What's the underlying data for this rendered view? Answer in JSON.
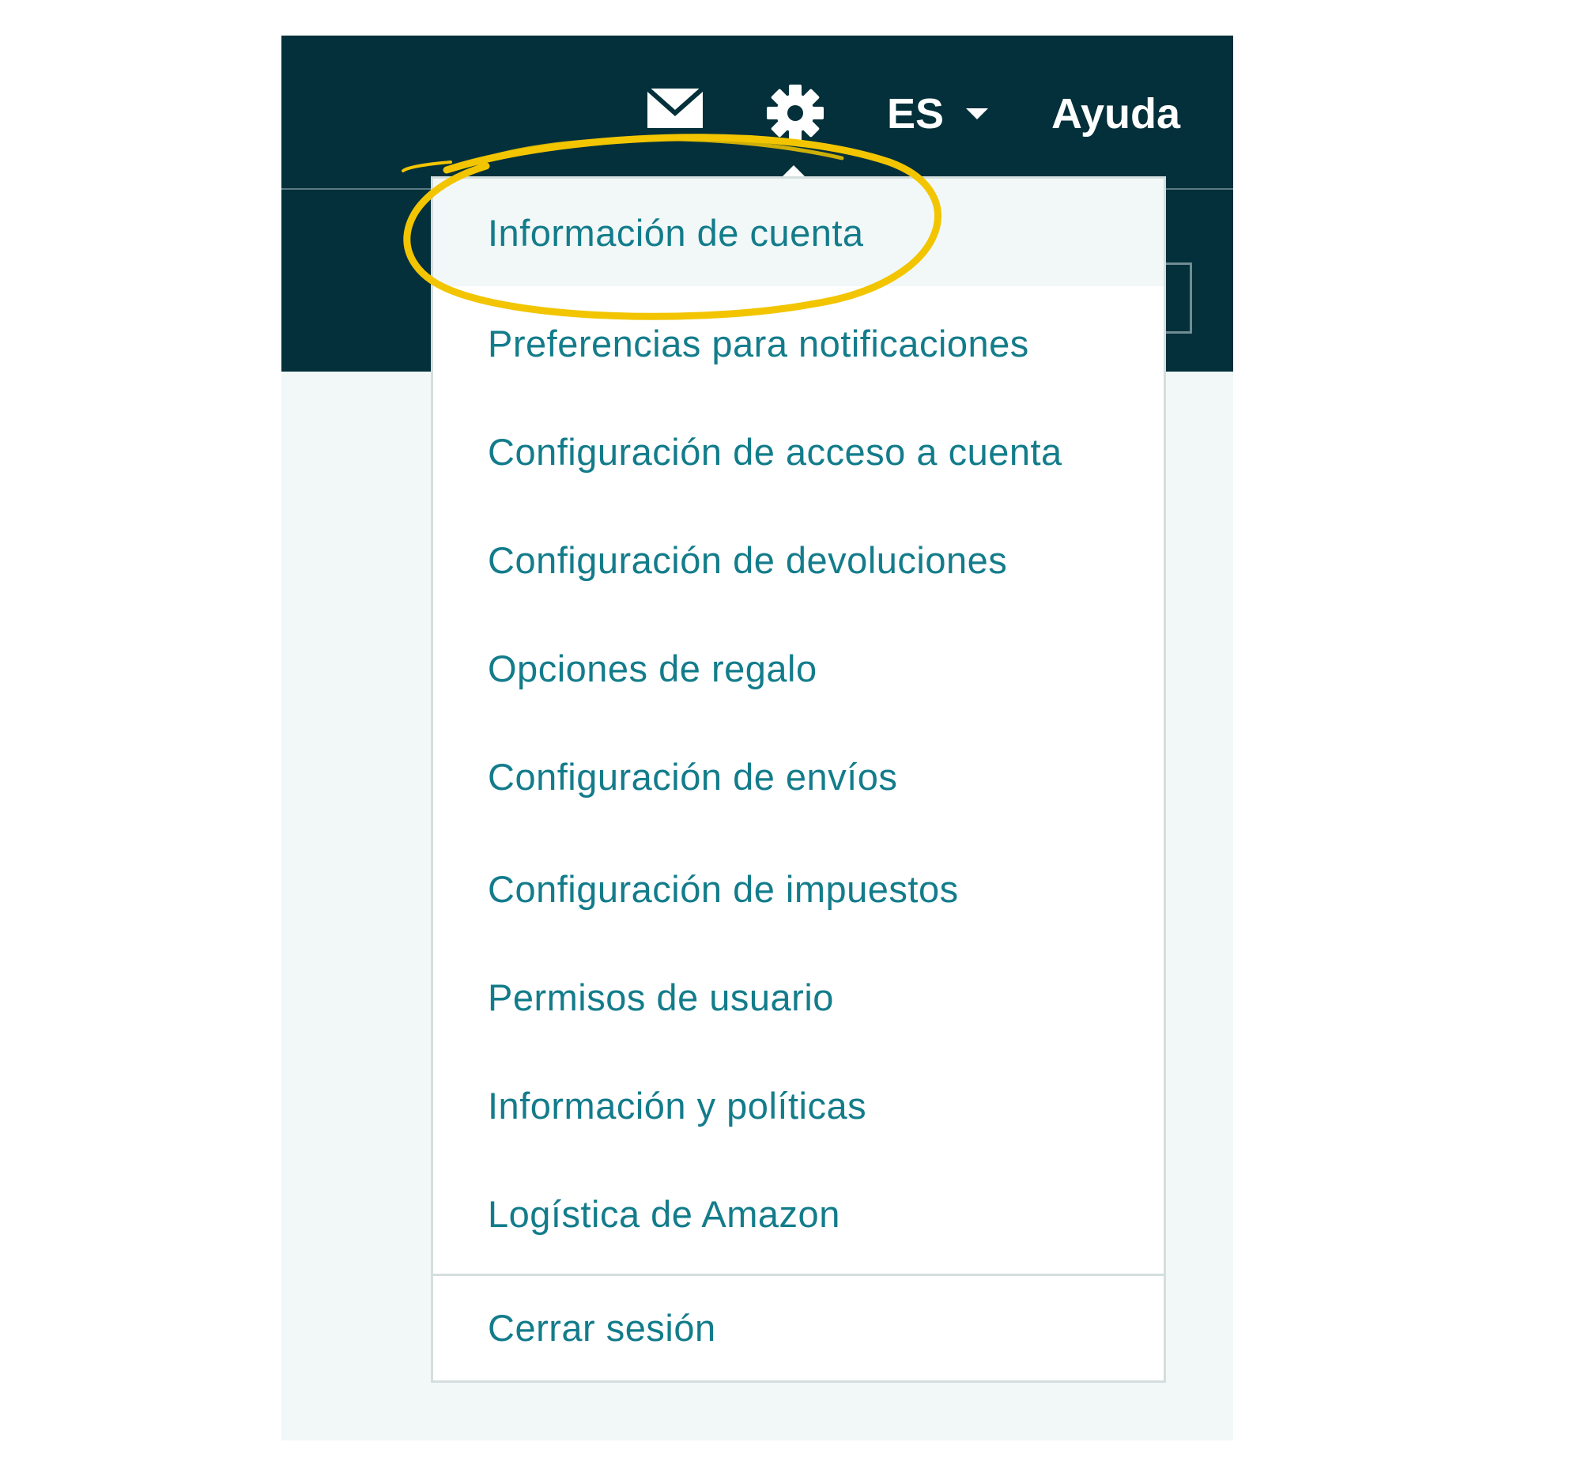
{
  "header": {
    "icons": {
      "mail": "mail-icon",
      "settings": "gear-icon",
      "language_caret": "caret-down-icon"
    },
    "language_label": "ES",
    "help_label": "Ayuda"
  },
  "settings_menu": {
    "items": [
      {
        "label": "Información de cuenta"
      },
      {
        "label": "Preferencias para notificaciones"
      },
      {
        "label": "Configuración de acceso a cuenta"
      },
      {
        "label": "Configuración de devoluciones"
      },
      {
        "label": "Opciones de regalo"
      },
      {
        "label": "Configuración de envíos"
      },
      {
        "label": "Configuración de impuestos"
      },
      {
        "label": "Permisos de usuario"
      },
      {
        "label": "Información y políticas"
      },
      {
        "label": "Logística de Amazon"
      }
    ],
    "logout_label": "Cerrar sesión"
  },
  "colors": {
    "header_bg": "#03303a",
    "page_bg": "#f2f8f7",
    "link": "#137c8b",
    "highlight_annotation": "#f2c500"
  }
}
